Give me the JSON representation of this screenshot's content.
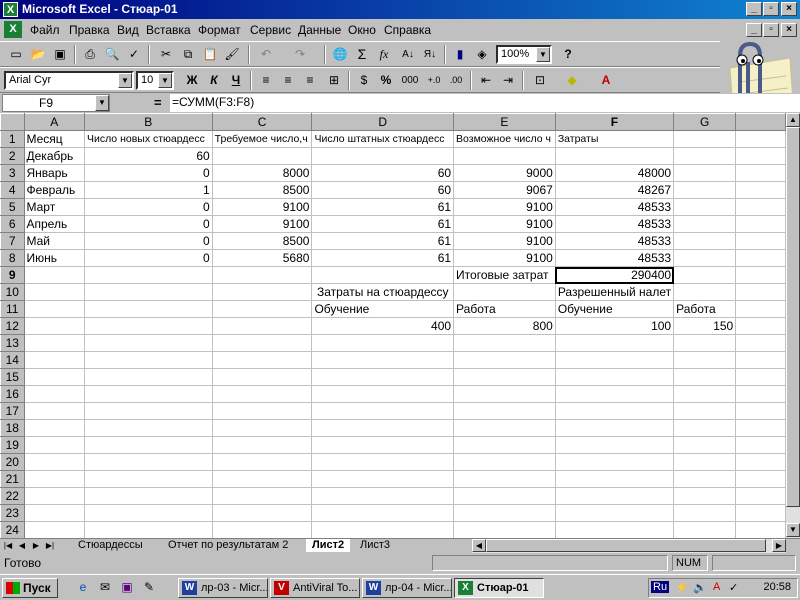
{
  "window": {
    "title": "Microsoft Excel - Стюар-01",
    "colors": {
      "titlebar": "#000080",
      "sheet_bg": "#ffffff",
      "chrome": "#c0c0c0"
    }
  },
  "menu": {
    "items": [
      "Файл",
      "Правка",
      "Вид",
      "Вставка",
      "Формат",
      "Сервис",
      "Данные",
      "Окно",
      "Справка"
    ]
  },
  "toolbar": {
    "zoom": "100%",
    "font": "Arial Cyr",
    "font_size": "10",
    "bold": "Ж",
    "italic": "К",
    "underline": "Ч",
    "percent": "%",
    "thousands": "000",
    "sigma": "Σ",
    "fx": "fx"
  },
  "formula_bar": {
    "cell_ref": "F9",
    "equals": "=",
    "formula": "=СУММ(F3:F8)"
  },
  "sheet": {
    "columns": [
      "A",
      "B",
      "C",
      "D",
      "E",
      "F",
      "G"
    ],
    "active_cell": "F9",
    "rows": [
      {
        "n": "1",
        "cells": [
          "Месяц",
          "Число новых стюардесс",
          "Требуемое число,ч",
          "Число штатных стюардесс",
          "Возможное число ч",
          "Затраты",
          ""
        ]
      },
      {
        "n": "2",
        "cells": [
          "Декабрь",
          "60",
          "",
          "",
          "",
          "",
          ""
        ]
      },
      {
        "n": "3",
        "cells": [
          "Январь",
          "0",
          "8000",
          "60",
          "9000",
          "48000",
          ""
        ]
      },
      {
        "n": "4",
        "cells": [
          "Февраль",
          "1",
          "8500",
          "60",
          "9067",
          "48267",
          ""
        ]
      },
      {
        "n": "5",
        "cells": [
          "Март",
          "0",
          "9100",
          "61",
          "9100",
          "48533",
          ""
        ]
      },
      {
        "n": "6",
        "cells": [
          "Апрель",
          "0",
          "9100",
          "61",
          "9100",
          "48533",
          ""
        ]
      },
      {
        "n": "7",
        "cells": [
          "Май",
          "0",
          "8500",
          "61",
          "9100",
          "48533",
          ""
        ]
      },
      {
        "n": "8",
        "cells": [
          "Июнь",
          "0",
          "5680",
          "61",
          "9100",
          "48533",
          ""
        ]
      },
      {
        "n": "9",
        "cells": [
          "",
          "",
          "",
          "",
          "Итоговые затрат",
          "290400",
          ""
        ]
      },
      {
        "n": "10",
        "cells": [
          "",
          "",
          "",
          "Затраты на стюардессу",
          "",
          "Разрешенный налет",
          ""
        ]
      },
      {
        "n": "11",
        "cells": [
          "",
          "",
          "",
          "Обучение",
          "Работа",
          "Обучение",
          "Работа"
        ]
      },
      {
        "n": "12",
        "cells": [
          "",
          "",
          "",
          "400",
          "800",
          "100",
          "150"
        ]
      },
      {
        "n": "13",
        "cells": [
          "",
          "",
          "",
          "",
          "",
          "",
          ""
        ]
      },
      {
        "n": "14",
        "cells": [
          "",
          "",
          "",
          "",
          "",
          "",
          ""
        ]
      },
      {
        "n": "15",
        "cells": [
          "",
          "",
          "",
          "",
          "",
          "",
          ""
        ]
      },
      {
        "n": "16",
        "cells": [
          "",
          "",
          "",
          "",
          "",
          "",
          ""
        ]
      },
      {
        "n": "17",
        "cells": [
          "",
          "",
          "",
          "",
          "",
          "",
          ""
        ]
      },
      {
        "n": "18",
        "cells": [
          "",
          "",
          "",
          "",
          "",
          "",
          ""
        ]
      },
      {
        "n": "19",
        "cells": [
          "",
          "",
          "",
          "",
          "",
          "",
          ""
        ]
      },
      {
        "n": "20",
        "cells": [
          "",
          "",
          "",
          "",
          "",
          "",
          ""
        ]
      },
      {
        "n": "21",
        "cells": [
          "",
          "",
          "",
          "",
          "",
          "",
          ""
        ]
      },
      {
        "n": "22",
        "cells": [
          "",
          "",
          "",
          "",
          "",
          "",
          ""
        ]
      },
      {
        "n": "23",
        "cells": [
          "",
          "",
          "",
          "",
          "",
          "",
          ""
        ]
      },
      {
        "n": "24",
        "cells": [
          "",
          "",
          "",
          "",
          "",
          "",
          ""
        ]
      }
    ]
  },
  "sheet_tabs": {
    "tabs": [
      "Стюардессы",
      "Отчет по результатам 2",
      "Лист2",
      "Лист3"
    ],
    "active": "Лист2"
  },
  "status": {
    "text": "Готово",
    "num": "NUM"
  },
  "taskbar": {
    "start": "Пуск",
    "buttons": [
      "лр-03 - Micr...",
      "AntiViral To...",
      "лр-04 - Micr...",
      "Стюар-01"
    ],
    "active": "Стюар-01",
    "lang": "Ru",
    "clock": "20:58"
  }
}
